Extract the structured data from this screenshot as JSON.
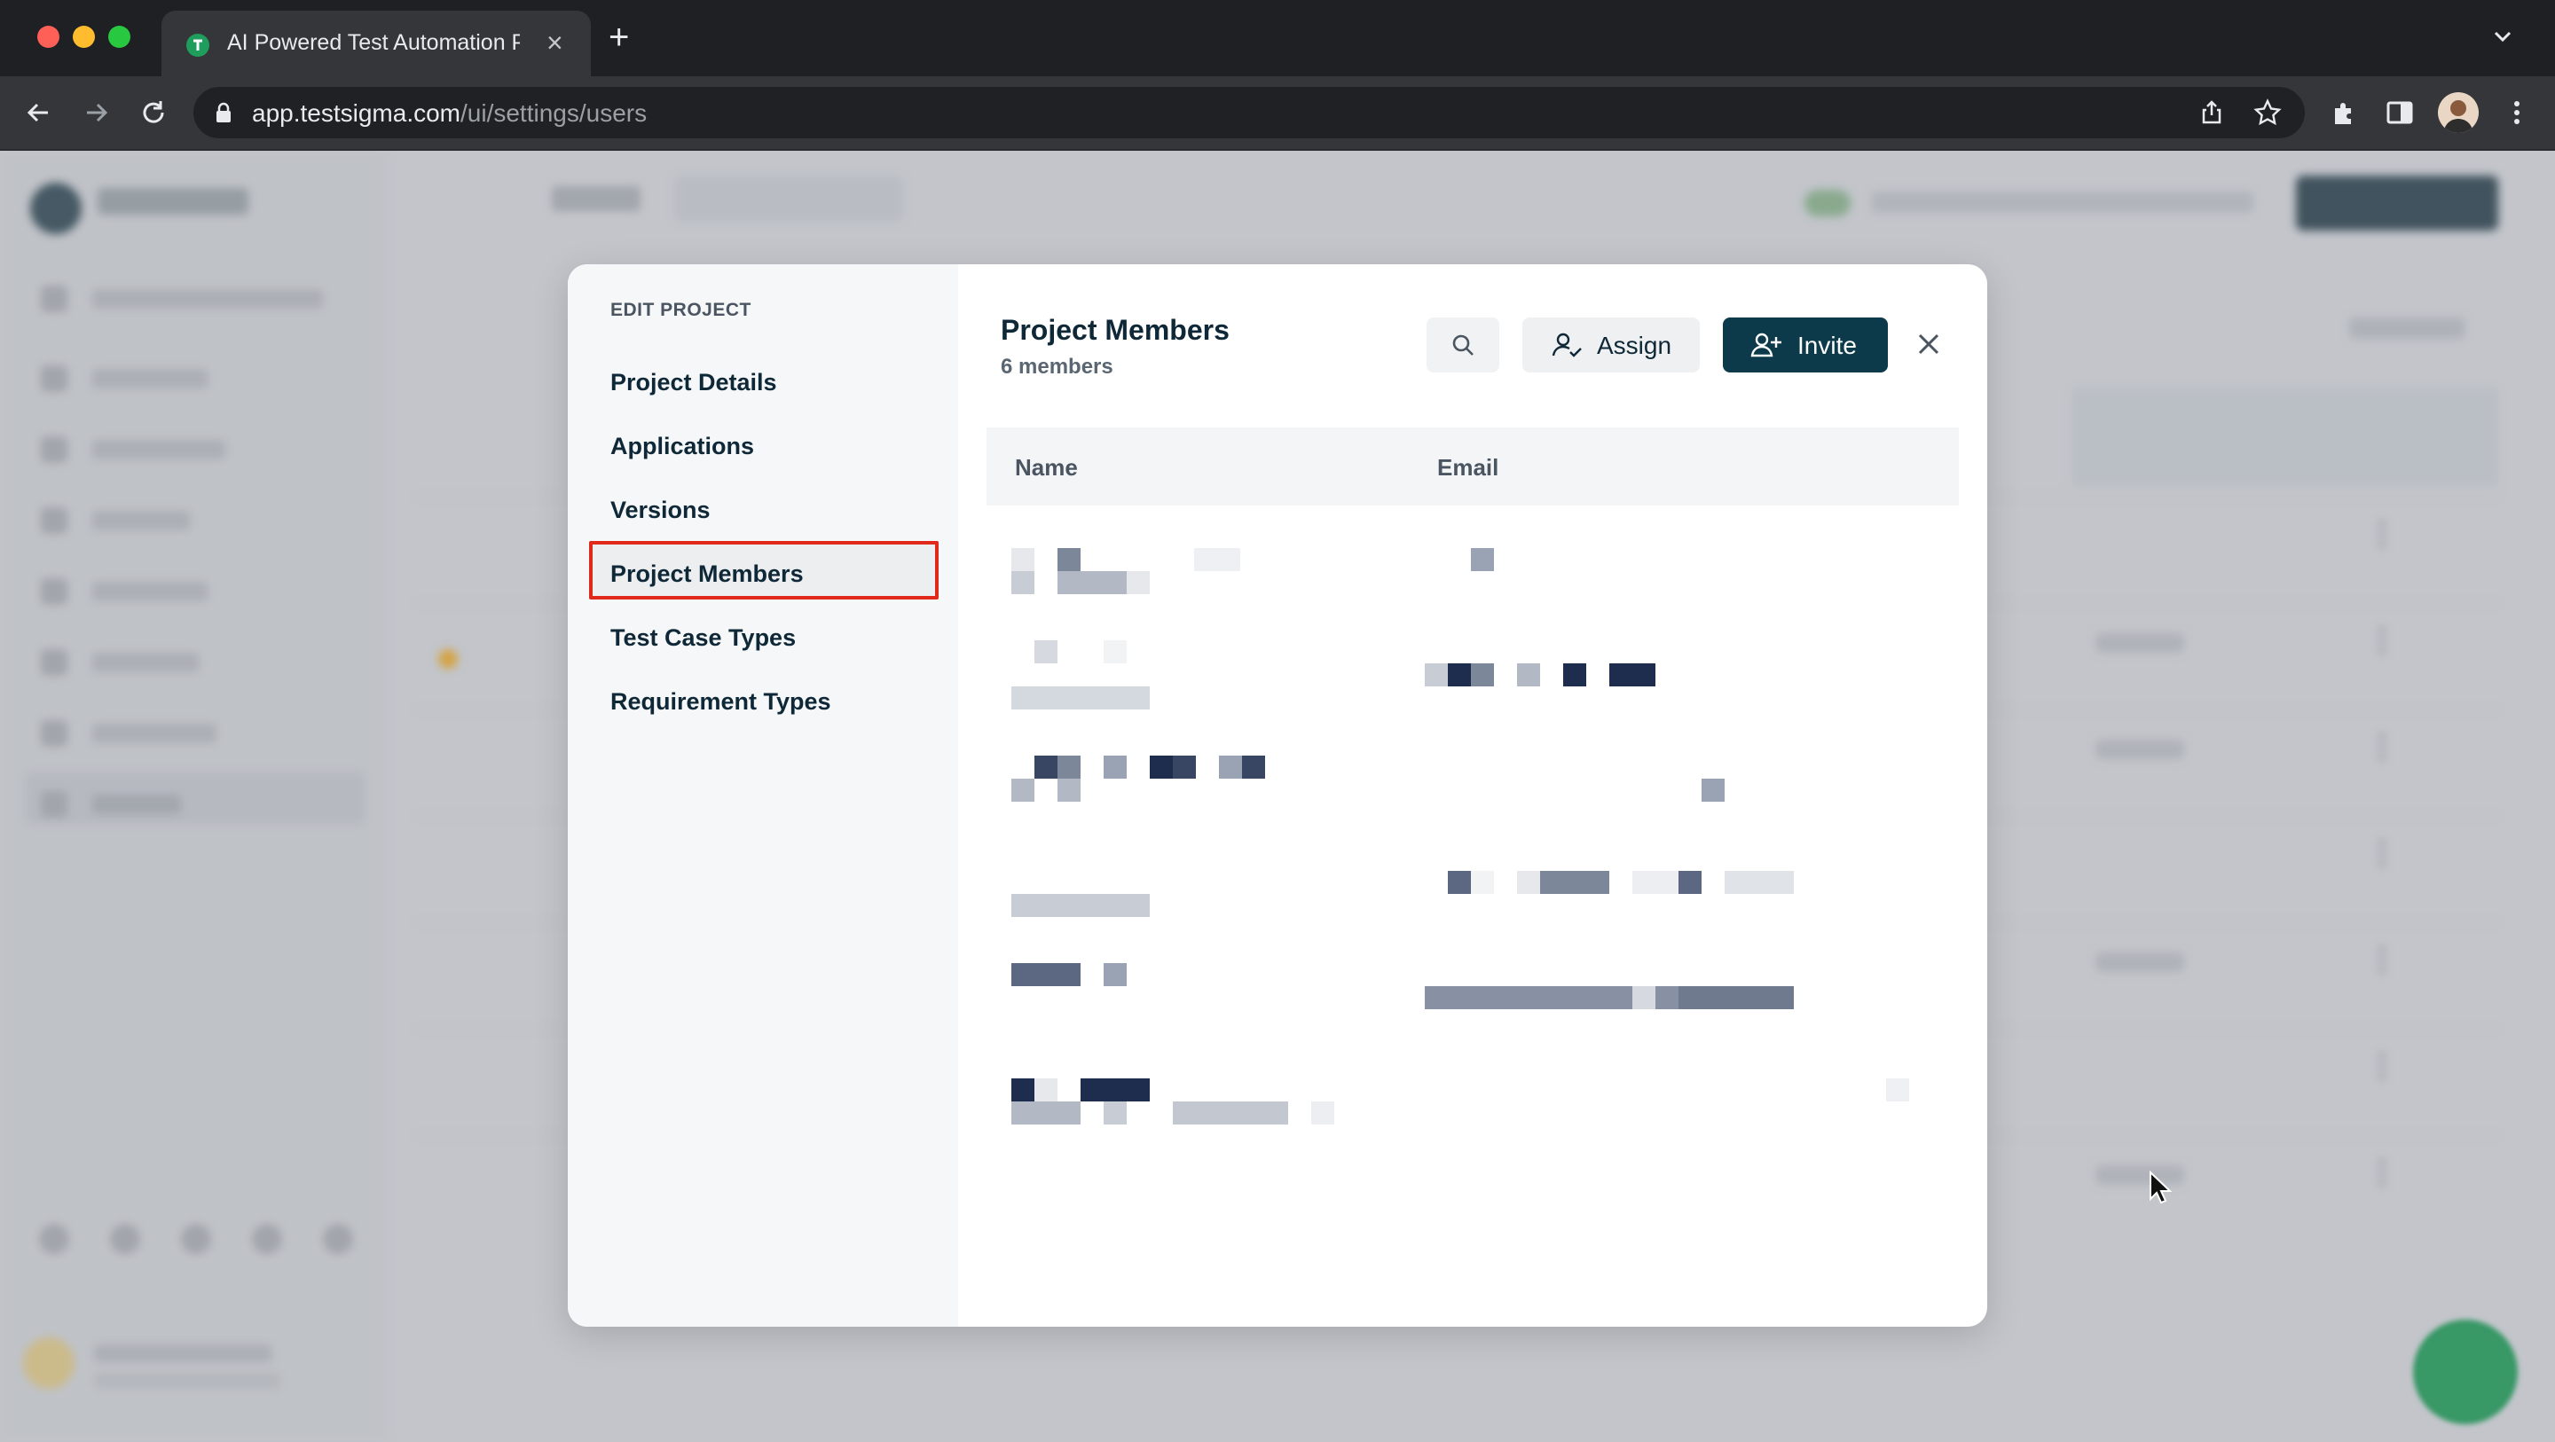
{
  "browser": {
    "tab_title": "AI Powered Test Automation P",
    "url_host": "app.testsigma.com",
    "url_path": "/ui/settings/users",
    "icons": [
      "back-icon",
      "forward-icon",
      "reload-icon",
      "lock-icon",
      "share-icon",
      "bookmark-star-icon",
      "extensions-icon",
      "side-panel-icon",
      "profile-avatar",
      "more-menu-icon"
    ]
  },
  "modal": {
    "nav_heading": "EDIT PROJECT",
    "nav_items": [
      {
        "label": "Project Details"
      },
      {
        "label": "Applications"
      },
      {
        "label": "Versions"
      },
      {
        "label": "Project Members",
        "selected": true
      },
      {
        "label": "Test Case Types"
      },
      {
        "label": "Requirement Types"
      }
    ],
    "title": "Project Members",
    "count": "6 members",
    "assign_label": "Assign",
    "invite_label": "Invite",
    "columns": {
      "name": "Name",
      "email": "Email"
    },
    "rows_note_redacted": true
  },
  "colors": {
    "primary": "#0d3a4b",
    "highlight_border": "#e0281b",
    "chrome_dark": "#35363a"
  }
}
